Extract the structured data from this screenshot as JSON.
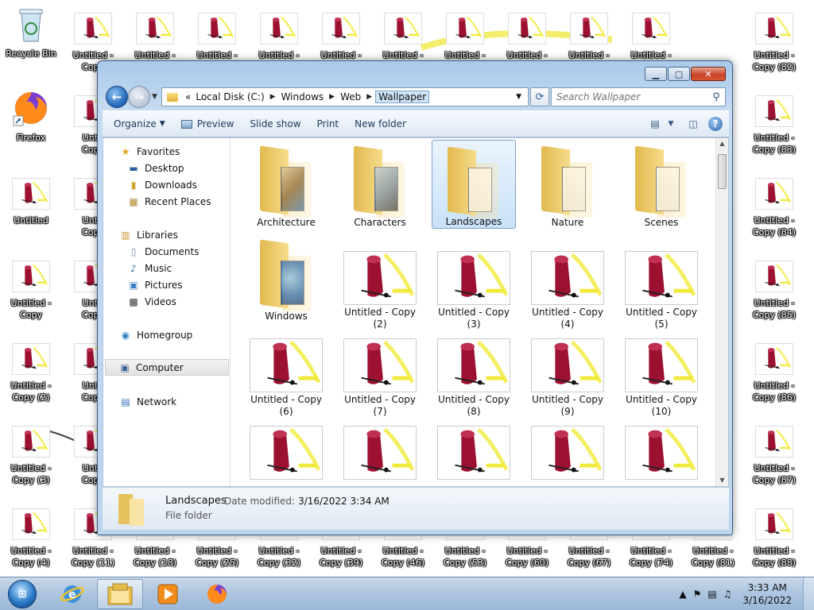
{
  "desktop": {
    "recycle_bin_label": "Recycle Bin",
    "firefox_label": "Firefox",
    "row0": [
      "Untitled -",
      "Untitled -",
      "Untitled -",
      "Untitled -",
      "Untitled -",
      "Untitled -",
      "Untitled -",
      "Untitled -",
      "Untitled -",
      "Untitled -",
      "Untitled -"
    ],
    "row0_line2": [
      "Copy",
      "",
      "",
      "",
      "",
      "",
      "",
      "",
      "",
      "",
      "Copy (82)"
    ],
    "col0": [
      {
        "l1": "Untitled",
        "l2": ""
      },
      {
        "l1": "Untitled -",
        "l2": "Copy"
      },
      {
        "l1": "Untitled -",
        "l2": "Copy (2)"
      },
      {
        "l1": "Untitled -",
        "l2": "Copy (3)"
      },
      {
        "l1": "Untitled -",
        "l2": "Copy (4)"
      }
    ],
    "col1": [
      {
        "l1": "Untit",
        "l2": "Copy"
      },
      {
        "l1": "Untit",
        "l2": "Copy"
      },
      {
        "l1": "Untit",
        "l2": "Copy"
      },
      {
        "l1": "Untit",
        "l2": "Copy"
      },
      {
        "l1": "Untit",
        "l2": "Copy"
      },
      {
        "l1": "Untitled -",
        "l2": "Copy (11)"
      }
    ],
    "right_col": [
      {
        "l1": "Untitled -",
        "l2": "Copy (83)"
      },
      {
        "l1": "Untitled -",
        "l2": "Copy (84)"
      },
      {
        "l1": "Untitled -",
        "l2": "Copy (85)"
      },
      {
        "l1": "Untitled -",
        "l2": "Copy (86)"
      },
      {
        "l1": "Untitled -",
        "l2": "Copy (87)"
      },
      {
        "l1": "Untitled -",
        "l2": "Copy (88)"
      }
    ],
    "bottom_row": [
      {
        "l1": "Untitled -",
        "l2": "Copy (18)"
      },
      {
        "l1": "Untitled -",
        "l2": "Copy (25)"
      },
      {
        "l1": "Untitled -",
        "l2": "Copy (32)"
      },
      {
        "l1": "Untitled -",
        "l2": "Copy (39)"
      },
      {
        "l1": "Untitled -",
        "l2": "Copy (46)"
      },
      {
        "l1": "Untitled -",
        "l2": "Copy (53)"
      },
      {
        "l1": "Untitled -",
        "l2": "Copy (60)"
      },
      {
        "l1": "Untitled -",
        "l2": "Copy (67)"
      },
      {
        "l1": "Untitled -",
        "l2": "Copy (74)"
      },
      {
        "l1": "Untitled -",
        "l2": "Copy (81)"
      }
    ]
  },
  "explorer": {
    "breadcrumb": {
      "chevrons": "«",
      "items": [
        "Local Disk (C:)",
        "Windows",
        "Web",
        "Wallpaper"
      ]
    },
    "search_placeholder": "Search Wallpaper",
    "toolbar": {
      "organize": "Organize",
      "preview": "Preview",
      "slideshow": "Slide show",
      "print": "Print",
      "new_folder": "New folder",
      "help": "?"
    },
    "nav": {
      "favorites": "Favorites",
      "desktop": "Desktop",
      "downloads": "Downloads",
      "recent_places": "Recent Places",
      "libraries": "Libraries",
      "documents": "Documents",
      "music": "Music",
      "pictures": "Pictures",
      "videos": "Videos",
      "homegroup": "Homegroup",
      "computer": "Computer",
      "network": "Network"
    },
    "folders": [
      "Architecture",
      "Characters",
      "Landscapes",
      "Nature",
      "Scenes",
      "Windows"
    ],
    "selected_folder": "Landscapes",
    "files": [
      {
        "l1": "Untitled - Copy",
        "l2": "(2)"
      },
      {
        "l1": "Untitled - Copy",
        "l2": "(3)"
      },
      {
        "l1": "Untitled - Copy",
        "l2": "(4)"
      },
      {
        "l1": "Untitled - Copy",
        "l2": "(5)"
      },
      {
        "l1": "Untitled - Copy",
        "l2": "(6)"
      },
      {
        "l1": "Untitled - Copy",
        "l2": "(7)"
      },
      {
        "l1": "Untitled - Copy",
        "l2": "(8)"
      },
      {
        "l1": "Untitled - Copy",
        "l2": "(9)"
      },
      {
        "l1": "Untitled - Copy",
        "l2": "(10)"
      }
    ],
    "details": {
      "name": "Landscapes",
      "modified_label": "Date modified:",
      "modified_value": "3/16/2022 3:34 AM",
      "type": "File folder"
    }
  },
  "taskbar": {
    "start_glyph": "⊞",
    "time": "3:33 AM",
    "date": "3/16/2022"
  },
  "colors": {
    "thumb_red": "#9c1030",
    "thumb_yellow": "#f1ea3a",
    "glass": "#bcd4ee"
  }
}
